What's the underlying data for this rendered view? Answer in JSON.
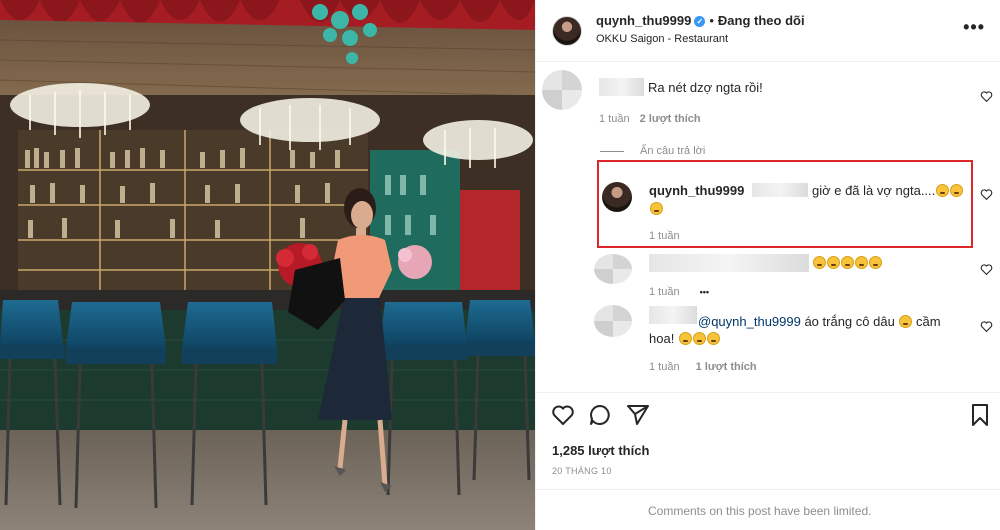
{
  "post_header": {
    "username": "quynh_thu9999",
    "separator": "•",
    "follow_status": "Đang theo dõi",
    "location": "OKKU Saigon - Restaurant",
    "more_icon": "more-horizontal-icon"
  },
  "comments": [
    {
      "text": "Ra nét dzợ ngta rồi!",
      "time": "1 tuần",
      "likes": "2 lượt thích"
    },
    {
      "hide_replies": "Ẩn câu trả lời",
      "username": "quynh_thu9999",
      "text": "giờ e đã là vợ ngta....",
      "time": "1 tuần"
    },
    {
      "time": "1 tuần",
      "more": "•••"
    },
    {
      "mention": "@quynh_thu9999",
      "text_a": " áo trắng cô dâu ",
      "text_b": " cầm",
      "text_c": "hoa! ",
      "time": "1 tuần",
      "likes": "1 lượt thích"
    }
  ],
  "stats": {
    "likes": "1,285 lượt thích",
    "date": "20 THÁNG 10"
  },
  "footer": {
    "limited_text": "Comments on this post have been limited."
  },
  "colors": {
    "highlight_border": "#e0262d",
    "verified": "#3897f0",
    "muted": "#8e8e8e"
  }
}
